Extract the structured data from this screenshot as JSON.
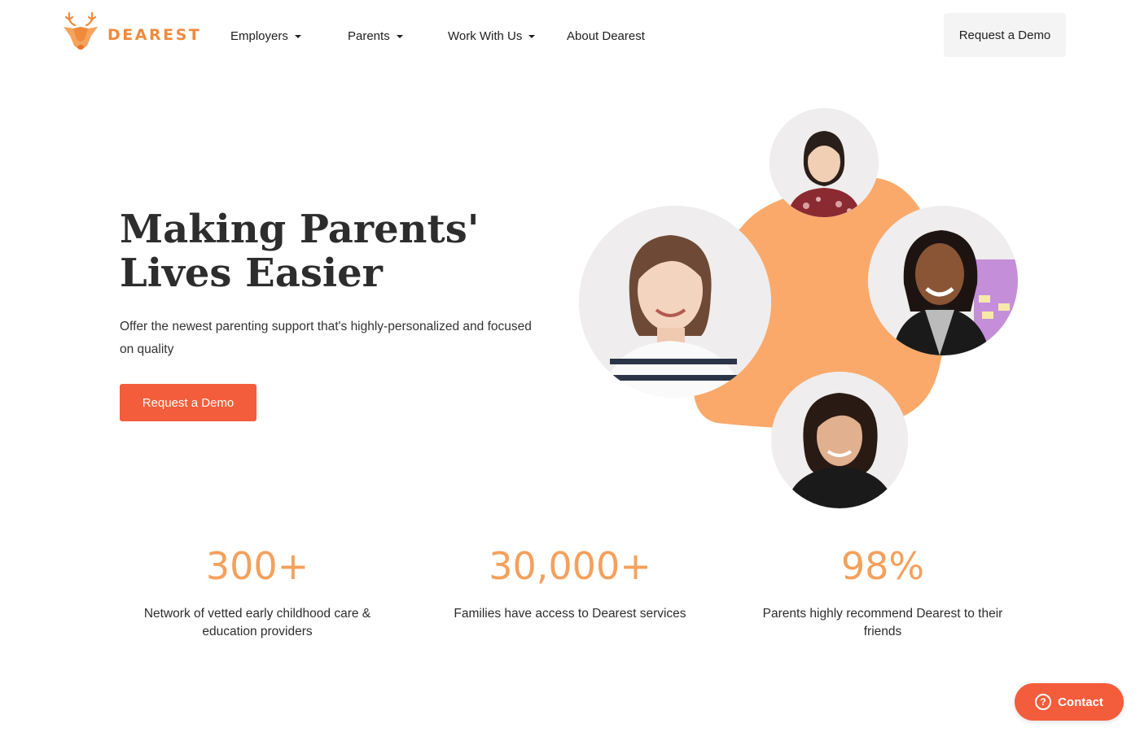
{
  "brand": {
    "name": "DEAREST",
    "color": "#f08a3c",
    "icon": "deer-head-icon"
  },
  "nav": {
    "items": [
      {
        "label": "Employers",
        "has_dropdown": true
      },
      {
        "label": "Parents",
        "has_dropdown": true
      },
      {
        "label": "Work With Us",
        "has_dropdown": true
      },
      {
        "label": "About Dearest",
        "has_dropdown": false
      }
    ],
    "cta_label": "Request a Demo"
  },
  "hero": {
    "title_line1": "Making Parents'",
    "title_line2": "Lives Easier",
    "subtitle": "Offer the newest parenting support that's highly-personalized and focused on quality",
    "cta_label": "Request a Demo",
    "accent_color": "#f45d3b",
    "blob_color": "#faa96a",
    "photo_icons": [
      "person-photo-icon",
      "person-photo-icon",
      "person-photo-icon",
      "person-photo-icon"
    ]
  },
  "stats": [
    {
      "value": "300+",
      "label": "Network of vetted early childhood care & education providers"
    },
    {
      "value": "30,000+",
      "label": "Families have access to Dearest services"
    },
    {
      "value": "98%",
      "label": "Parents highly recommend Dearest to their friends"
    }
  ],
  "contact": {
    "label": "Contact",
    "icon": "question-circle-icon"
  }
}
